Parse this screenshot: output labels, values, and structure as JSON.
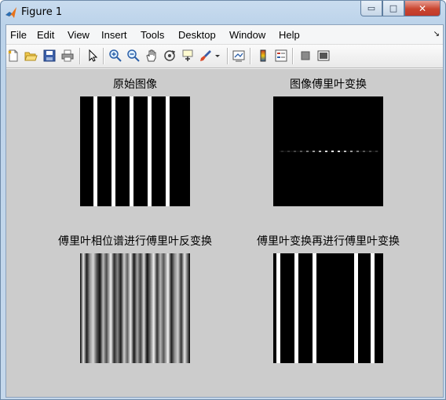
{
  "window": {
    "title": "Figure 1"
  },
  "window_controls": {
    "minimize": "▭",
    "maximize": "□",
    "close": "✕"
  },
  "menubar": {
    "items": [
      {
        "label": "File"
      },
      {
        "label": "Edit"
      },
      {
        "label": "View"
      },
      {
        "label": "Insert"
      },
      {
        "label": "Tools"
      },
      {
        "label": "Desktop"
      },
      {
        "label": "Window"
      },
      {
        "label": "Help"
      }
    ],
    "overflow": "↘"
  },
  "toolbar": {
    "icons": [
      "new-figure-icon",
      "open-file-icon",
      "save-icon",
      "print-icon",
      "select-arrow-icon",
      "zoom-in-icon",
      "zoom-out-icon",
      "pan-hand-icon",
      "rotate-3d-icon",
      "data-cursor-icon",
      "brush-icon",
      "brush-dropdown-icon",
      "link-plot-icon",
      "colorbar-icon",
      "legend-icon",
      "hide-plot-tools-icon",
      "show-plot-tools-icon"
    ]
  },
  "subplots": [
    {
      "title": "原始图像",
      "kind": "stripes-sharp"
    },
    {
      "title": "图像傅里叶变换",
      "kind": "spectrum"
    },
    {
      "title": "傅里叶相位谱进行傅里叶反变换",
      "kind": "stripes-gradient"
    },
    {
      "title": "傅里叶变换再进行傅里叶变换",
      "kind": "stripes-mirrored"
    }
  ],
  "colors": {
    "figure_background": "#cccccc",
    "image_black": "#000000",
    "image_white": "#ffffff"
  }
}
